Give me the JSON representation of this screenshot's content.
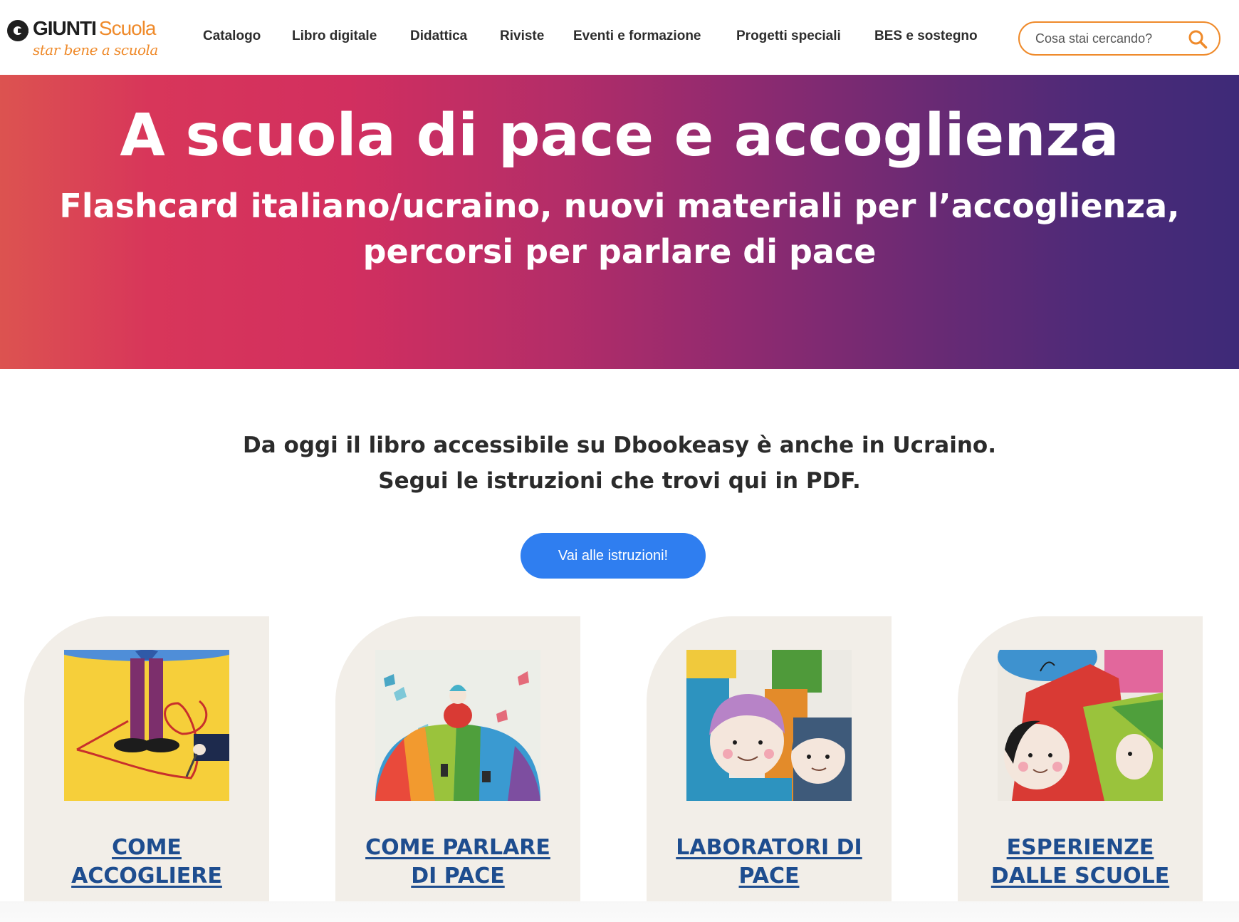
{
  "header": {
    "logo": {
      "brand_main": "GIUNTI",
      "brand_accent": "Scuola",
      "tagline": "star bene a scuola"
    },
    "nav": [
      {
        "label": "Catalogo"
      },
      {
        "label": "Libro digitale"
      },
      {
        "label": "Didattica"
      },
      {
        "label": "Riviste"
      },
      {
        "label": "Eventi e formazione"
      },
      {
        "label": "Progetti speciali"
      },
      {
        "label": "BES e sostegno"
      }
    ],
    "search": {
      "placeholder": "Cosa stai cercando?",
      "icon": "search-icon"
    }
  },
  "hero": {
    "title": "A scuola di pace e accoglienza",
    "subtitle_line1": "Flashcard italiano/ucraino, nuovi materiali per l’accoglienza,",
    "subtitle_line2": "percorsi per parlare di pace"
  },
  "intro": {
    "line1": "Da oggi il libro accessibile su Dbookeasy è anche in Ucraino.",
    "line2": "Segui le istruzioni che trovi qui in PDF.",
    "cta_label": "Vai alle istruzioni!"
  },
  "cards": [
    {
      "line1": "COME",
      "line2": "ACCOGLIERE"
    },
    {
      "line1": "COME PARLARE",
      "line2": "DI PACE"
    },
    {
      "line1": "LABORATORI DI",
      "line2": "PACE"
    },
    {
      "line1": "ESPERIENZE",
      "line2": "DALLE SCUOLE"
    }
  ],
  "colors": {
    "accent_orange": "#ef8a2a",
    "cta_blue": "#2f7ef0",
    "link_blue": "#1e4d8f",
    "card_bg": "#f2eee8",
    "hero_gradient_start": "#dc5350",
    "hero_gradient_end": "#3e2a78"
  }
}
